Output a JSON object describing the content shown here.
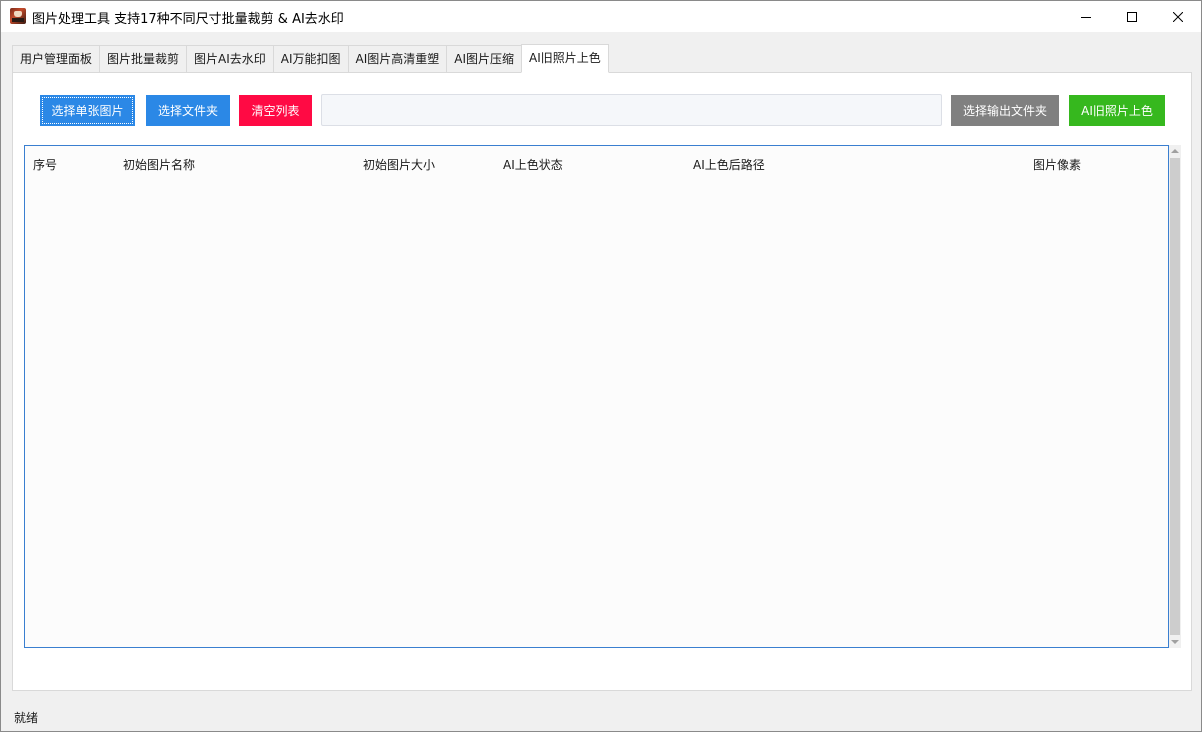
{
  "window": {
    "title": "图片处理工具 支持17种不同尺寸批量裁剪 & AI去水印",
    "icon": "app-portrait-icon",
    "controls": [
      "minimize-icon",
      "maximize-icon",
      "close-icon"
    ]
  },
  "tabs": [
    {
      "label": "用户管理面板",
      "active": false
    },
    {
      "label": "图片批量裁剪",
      "active": false
    },
    {
      "label": "图片AI去水印",
      "active": false
    },
    {
      "label": "AI万能扣图",
      "active": false
    },
    {
      "label": "AI图片高清重塑",
      "active": false
    },
    {
      "label": "AI图片压缩",
      "active": false
    },
    {
      "label": "AI旧照片上色",
      "active": true
    }
  ],
  "toolbar": {
    "select_single_label": "选择单张图片",
    "select_folder_label": "选择文件夹",
    "clear_list_label": "清空列表",
    "path_value": "",
    "select_output_label": "选择输出文件夹",
    "colorize_label": "AI旧照片上色"
  },
  "list": {
    "columns": [
      "序号",
      "初始图片名称",
      "初始图片大小",
      "AI上色状态",
      "AI上色后路径",
      "图片像素"
    ],
    "rows": []
  },
  "status": {
    "text": "就绪"
  },
  "colors": {
    "blue_button": "#2b88e6",
    "red_button": "#ff0a44",
    "gray_button": "#808080",
    "green_button": "#36b81e",
    "list_border": "#3a7fd0"
  }
}
